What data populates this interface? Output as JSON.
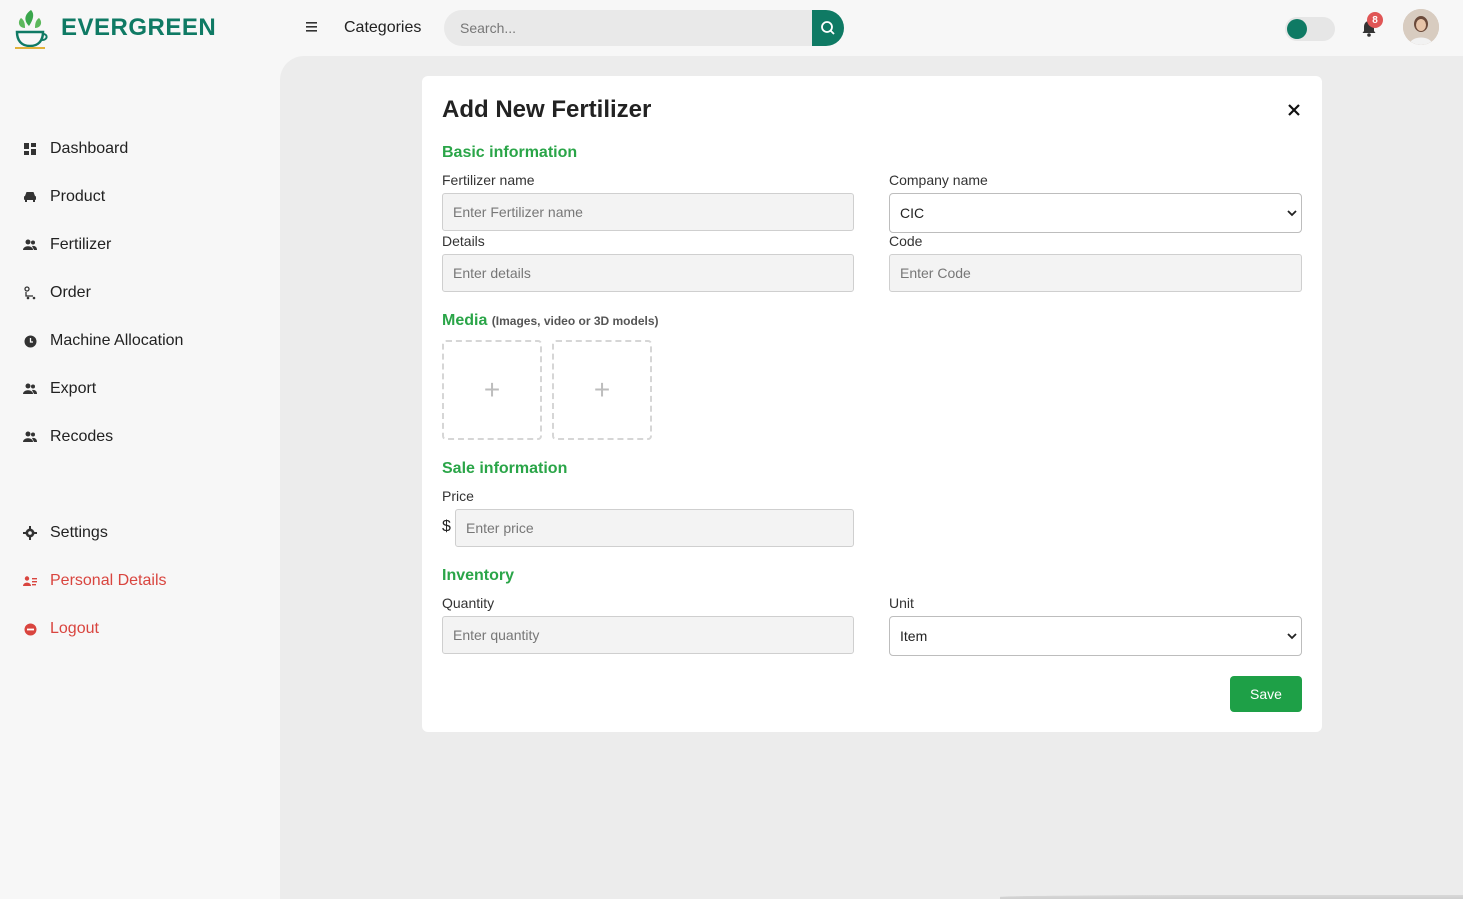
{
  "brand": {
    "name": "EVERGREEN",
    "color": "#0f7a64"
  },
  "header": {
    "categories_label": "Categories",
    "search_placeholder": "Search...",
    "notification_count": "8"
  },
  "sidebar": {
    "items": [
      {
        "label": "Dashboard",
        "icon": "dashboard-icon"
      },
      {
        "label": "Product",
        "icon": "car-icon"
      },
      {
        "label": "Fertilizer",
        "icon": "users-icon"
      },
      {
        "label": "Order",
        "icon": "order-icon"
      },
      {
        "label": "Machine Allocation",
        "icon": "clock-icon"
      },
      {
        "label": "Export",
        "icon": "users-icon"
      },
      {
        "label": "Recodes",
        "icon": "users-icon"
      }
    ],
    "bottom_items": [
      {
        "label": "Settings",
        "icon": "gear-icon"
      },
      {
        "label": "Personal Details",
        "icon": "id-card-icon"
      },
      {
        "label": "Logout",
        "icon": "logout-icon"
      }
    ]
  },
  "form": {
    "title": "Add New Fertilizer",
    "basic_info_title": "Basic information",
    "fertilizer_name_label": "Fertilizer name",
    "fertilizer_name_placeholder": "Enter Fertilizer name",
    "company_name_label": "Company name",
    "company_name_value": "CIC",
    "details_label": "Details",
    "details_placeholder": "Enter details",
    "code_label": "Code",
    "code_placeholder": "Enter Code",
    "media_title": "Media",
    "media_subtitle": "(Images, video or 3D models)",
    "media_add_symbol": "+",
    "sale_info_title": "Sale information",
    "price_label": "Price",
    "price_currency": "$",
    "price_placeholder": "Enter price",
    "inventory_title": "Inventory",
    "quantity_label": "Quantity",
    "quantity_placeholder": "Enter quantity",
    "unit_label": "Unit",
    "unit_value": "Item",
    "save_label": "Save"
  },
  "colors": {
    "accent_green": "#2aa548",
    "save_button": "#1ea047",
    "danger_red": "#d9453f"
  }
}
